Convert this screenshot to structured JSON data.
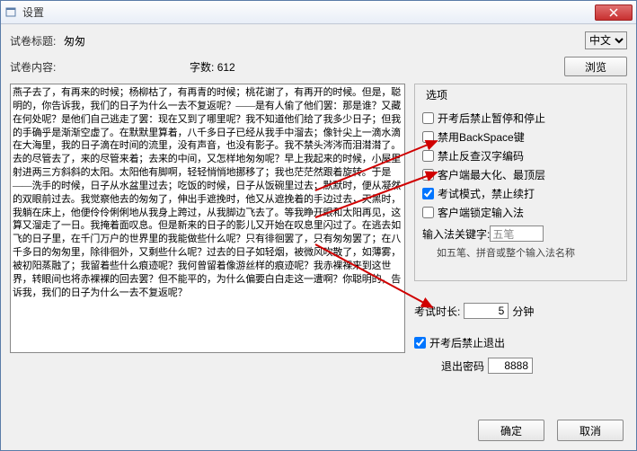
{
  "window": {
    "title": "设置"
  },
  "fields": {
    "title_label": "试卷标题:",
    "title_value": "匆匆",
    "language": "中文",
    "content_label": "试卷内容:",
    "wordcount_label": "字数:",
    "wordcount_value": "612",
    "browse_btn": "浏览",
    "content_text": "燕子去了，有再来的时候；杨柳枯了，有再青的时候；桃花谢了，有再开的时候。但是，聪明的，你告诉我，我们的日子为什么一去不复返呢？——是有人偷了他们罢：那是谁？又藏在何处呢？是他们自己逃走了罢：现在又到了哪里呢？我不知道他们给了我多少日子；但我的手确乎是渐渐空虚了。在默默里算着，八千多日子已经从我手中溜去；像针尖上一滴水滴在大海里，我的日子滴在时间的流里，没有声音，也没有影子。我不禁头涔涔而泪潸潸了。去的尽管去了，来的尽管来着；去来的中间，又怎样地匆匆呢？早上我起来的时候，小屋里射进两三方斜斜的太阳。太阳他有脚啊，轻轻悄悄地挪移了；我也茫茫然跟着旋转。于是——洗手的时候，日子从水盆里过去；吃饭的时候，日子从饭碗里过去；默默时，便从凝然的双眼前过去。我觉察他去的匆匆了，伸出手遮挽时，他又从遮挽着的手边过去，天黑时，我躺在床上，他便伶伶俐俐地从我身上跨过，从我脚边飞去了。等我睁开眼和太阳再见，这算又溜走了一日。我掩着面叹息。但是新来的日子的影儿又开始在叹息里闪过了。在逃去如飞的日子里，在千门万户的世界里的我能做些什么呢？只有徘徊罢了，只有匆匆罢了；在八千多日的匆匆里，除徘徊外，又剩些什么呢？过去的日子如轻烟，被微风吹散了，如薄雾，被初阳蒸融了；我留着些什么痕迹呢？我何曾留着像游丝样的痕迹呢？我赤裸裸来到这世界，转眼间也将赤裸裸的回去罢？但不能平的，为什么偏要白白走这一遭啊？你聪明的，告诉我，我们的日子为什么一去不复返呢？"
  },
  "options": {
    "legend": "选项",
    "items": [
      {
        "label": "开考后禁止暂停和停止",
        "checked": false
      },
      {
        "label": "禁用BackSpace键",
        "checked": false
      },
      {
        "label": "禁止反查汉字编码",
        "checked": false
      },
      {
        "label": "客户端最大化、最顶层",
        "checked": false
      },
      {
        "label": "考试模式，禁止续打",
        "checked": true
      },
      {
        "label": "客户端锁定输入法",
        "checked": false
      }
    ],
    "ime_label": "输入法关键字:",
    "ime_value": "五笔",
    "ime_hint": "如五笔、拼音或整个输入法名称",
    "duration_label": "考试时长:",
    "duration_value": "5",
    "duration_unit": "分钟",
    "exit_label": "开考后禁止退出",
    "exit_pwd_label": "退出密码",
    "exit_pwd_value": "8888"
  },
  "buttons": {
    "ok": "确定",
    "cancel": "取消"
  }
}
